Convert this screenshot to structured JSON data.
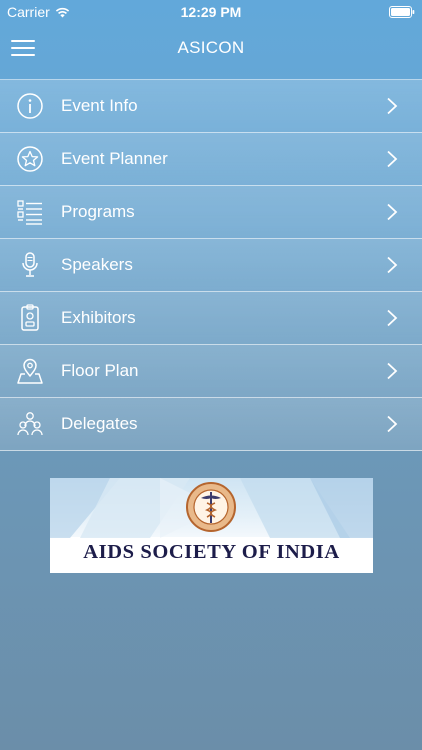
{
  "status_bar": {
    "carrier": "Carrier",
    "time": "12:29 PM"
  },
  "header": {
    "title": "ASICON"
  },
  "menu": {
    "items": [
      {
        "label": "Event Info",
        "icon": "info-icon"
      },
      {
        "label": "Event Planner",
        "icon": "star-icon"
      },
      {
        "label": "Programs",
        "icon": "list-icon"
      },
      {
        "label": "Speakers",
        "icon": "microphone-icon"
      },
      {
        "label": "Exhibitors",
        "icon": "badge-icon"
      },
      {
        "label": "Floor Plan",
        "icon": "map-pin-icon"
      },
      {
        "label": "Delegates",
        "icon": "people-icon"
      }
    ]
  },
  "banner": {
    "text": "AIDS SOCIETY OF INDIA"
  },
  "colors": {
    "background_top": "#62a8da",
    "background_bottom": "#6b8ea9",
    "banner_text": "#1d1d4a",
    "emblem": "#b5652e"
  }
}
